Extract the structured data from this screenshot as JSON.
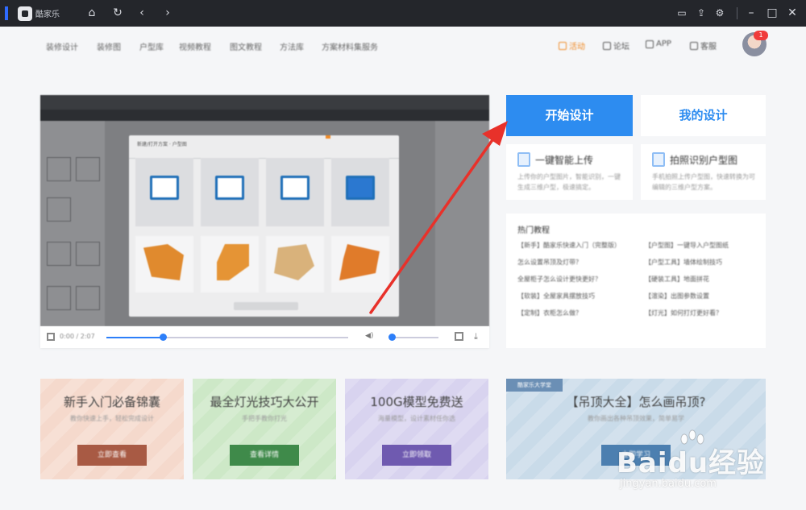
{
  "titlebar": {
    "app_name": "酷家乐",
    "icons": [
      "home-icon",
      "refresh-icon",
      "back-icon",
      "forward-icon",
      "message-icon",
      "share-icon",
      "settings-icon",
      "minimize-icon",
      "maximize-icon",
      "close-icon"
    ]
  },
  "nav": {
    "items": [
      "装修设计",
      "装修图",
      "户型库",
      "视频教程",
      "图文教程",
      "方法库",
      "方案材料集服务"
    ],
    "right_items": [
      "活动",
      "论坛",
      "APP",
      "客服"
    ],
    "notification_count": "1"
  },
  "video": {
    "modal_title": "新建/打开方案 · 户型图",
    "time": "0:00 / 2:07"
  },
  "actions": {
    "start_design": "开始设计",
    "my_design": "我的设计"
  },
  "features": [
    {
      "title": "一键智能上传",
      "desc": "上传你的户型图片，智能识别，一键生成三维户型，极速搞定。"
    },
    {
      "title": "拍照识别户型图",
      "desc": "手机拍照上传户型图，快速转换为可编辑的三维户型方案。"
    }
  ],
  "hot": {
    "title": "热门教程",
    "items": [
      "【新手】酷家乐快速入门（完整版）",
      "【户型图】一键导入户型图纸",
      "怎么设置吊顶及灯带？",
      "【户型工具】墙体绘制技巧",
      "全屋柜子怎么设计更快更好？",
      "【硬装工具】地面拼花",
      "【软装】全屋家具摆放技巧",
      "【渲染】出图参数设置",
      "【定制】衣柜怎么做？",
      "【灯光】如何打灯更好看？"
    ]
  },
  "banners": [
    {
      "title": "新手入门必备锦囊",
      "sub": "教你快速上手，轻松完成设计",
      "button": "立即查看"
    },
    {
      "title": "最全灯光技巧大公开",
      "sub": "手把手教你打光",
      "button": "查看详情"
    },
    {
      "title": "100G模型免费送",
      "sub": "海量模型，设计素材任你选",
      "button": "立即领取"
    },
    {
      "title": "【吊顶大全】怎么画吊顶?",
      "sub": "教你画出各种吊顶效果，简单易学",
      "button": "立即学习",
      "tag": "酷家乐大学堂"
    }
  ],
  "watermark": {
    "main": "Baidu经验",
    "sub": "jingyan.baidu.com"
  },
  "colors": {
    "accent": "#2d8cf0",
    "arrow": "#e8312a",
    "titlebar": "#24262b"
  }
}
